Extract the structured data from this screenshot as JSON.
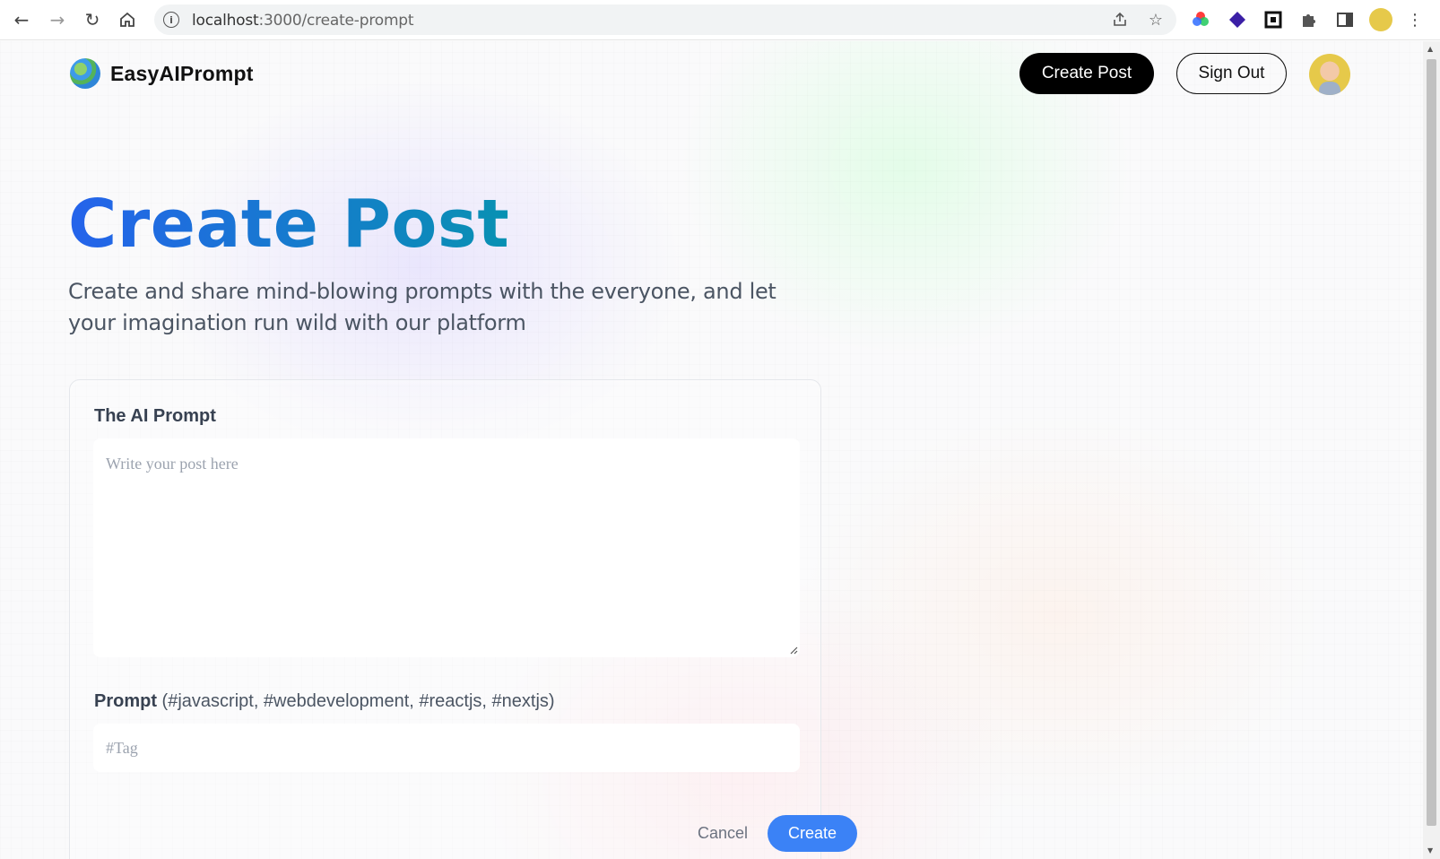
{
  "browser": {
    "url_host": "localhost",
    "url_path": ":3000/create-prompt"
  },
  "header": {
    "brand": "EasyAIPrompt",
    "create_post_label": "Create Post",
    "sign_out_label": "Sign Out"
  },
  "hero": {
    "title": "Create Post",
    "description": "Create and share mind-blowing prompts with the everyone, and let your imagination run wild with our platform"
  },
  "form": {
    "prompt_label": "The AI Prompt",
    "prompt_placeholder": "Write your post here",
    "tag_label_strong": "Prompt",
    "tag_label_hint": " (#javascript, #webdevelopment, #reactjs, #nextjs)",
    "tag_placeholder": "#Tag",
    "cancel_label": "Cancel",
    "submit_label": "Create"
  },
  "colors": {
    "primary": "#3b82f6",
    "gradient_start": "#2563eb",
    "gradient_end": "#0891b2"
  }
}
